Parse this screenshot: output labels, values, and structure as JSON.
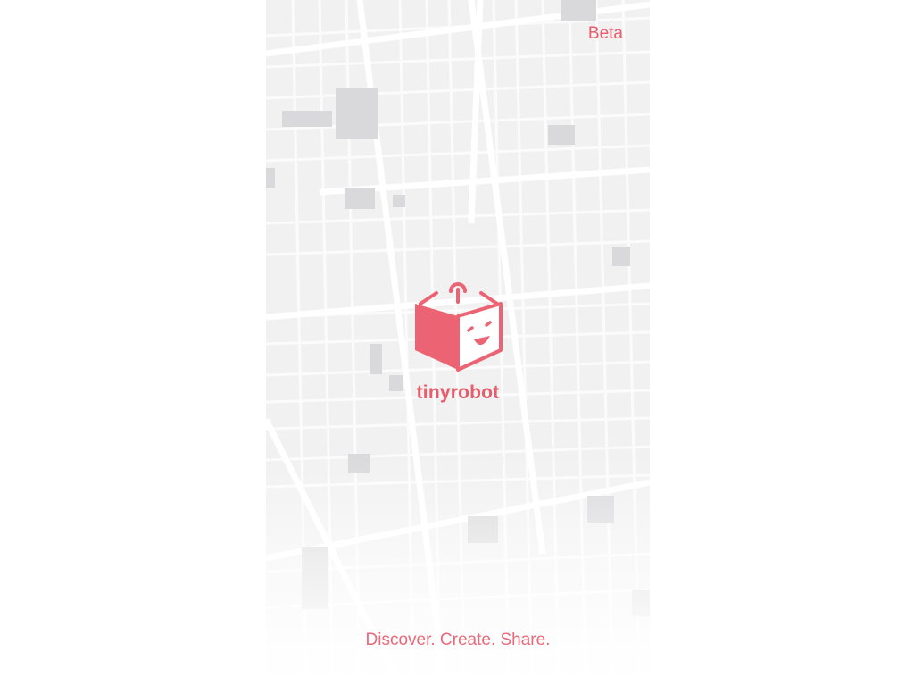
{
  "header": {
    "badge": "Beta"
  },
  "splash": {
    "app_name": "tinyrobot",
    "logo_icon": "robot-cube-icon",
    "tagline": "Discover. Create. Share."
  },
  "background": {
    "type": "map",
    "colors": {
      "land": "#f1f1f2",
      "road": "#ffffff",
      "building": "#d9d9db"
    }
  },
  "colors": {
    "accent": "#e85c6c",
    "page_background": "#ffffff"
  }
}
